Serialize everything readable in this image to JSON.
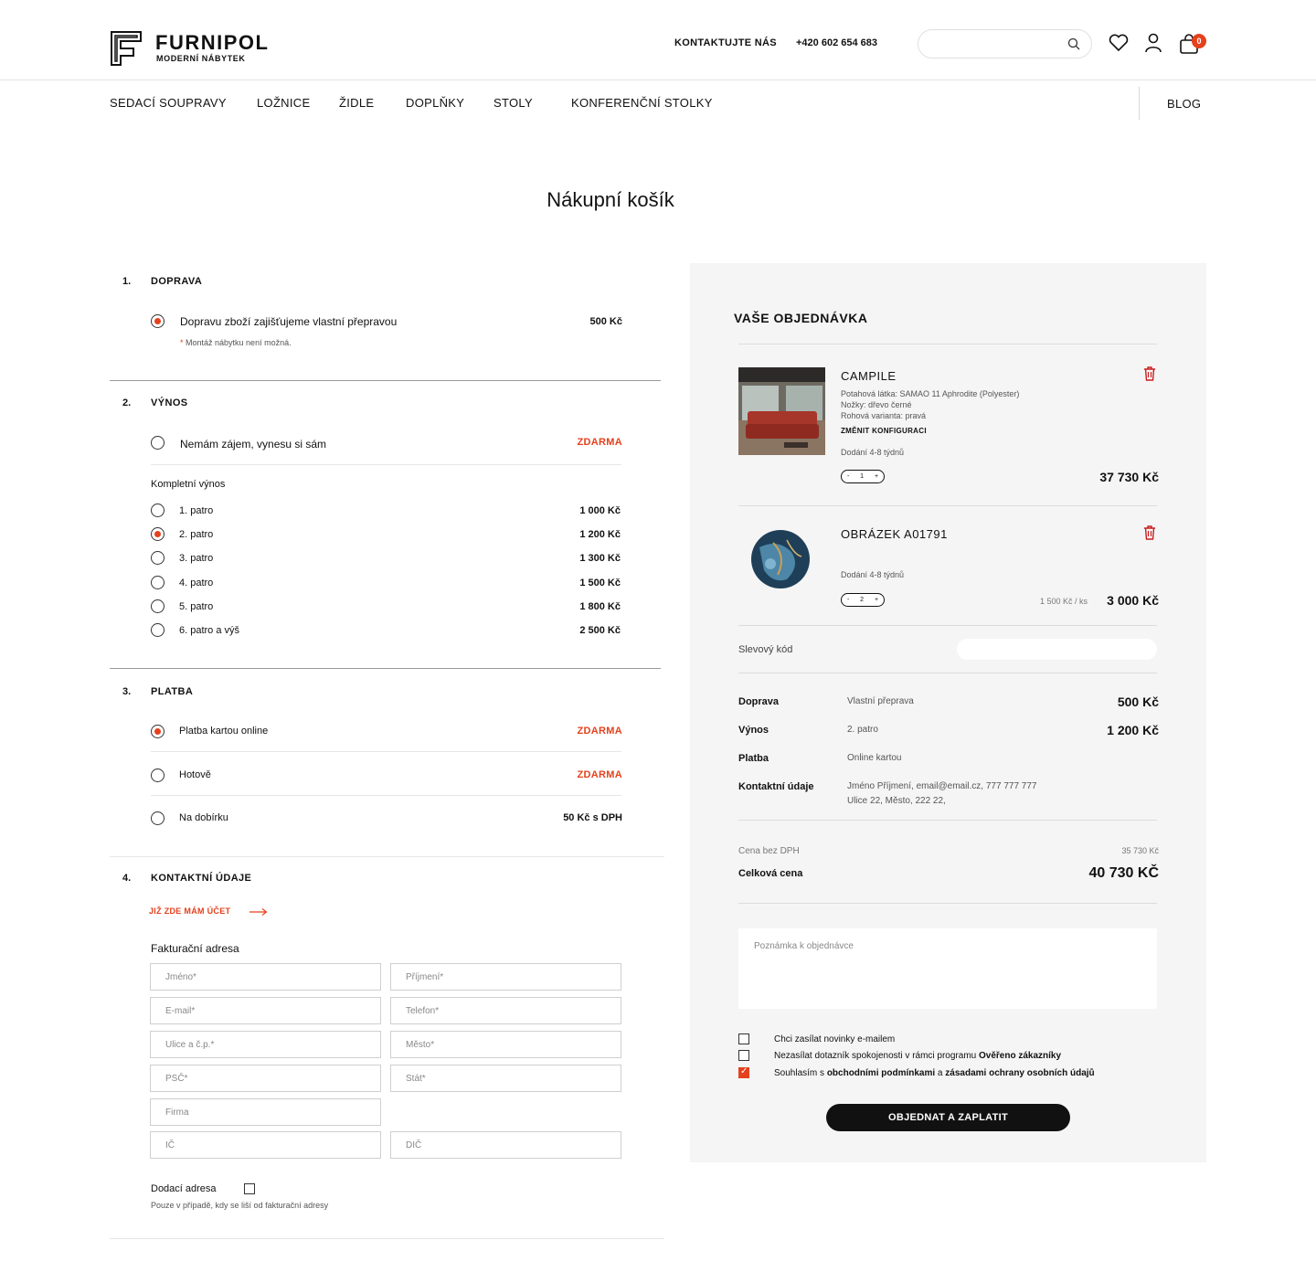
{
  "header": {
    "brand": "FURNIPOL",
    "brand_sub": "MODERNÍ NÁBYTEK",
    "contact_label": "KONTAKTUJTE NÁS",
    "phone": "+420 602 654 683",
    "cart_count": "0"
  },
  "nav": {
    "items": [
      "SEDACÍ SOUPRAVY",
      "LOŽNICE",
      "ŽIDLE",
      "DOPLŇKY",
      "STOLY",
      "KONFERENČNÍ STOLKY"
    ],
    "blog": "BLOG"
  },
  "page_title": "Nákupní košík",
  "shipping": {
    "num": "1.",
    "title": "DOPRAVA",
    "option_label": "Dopravu zboží zajišťujeme vlastní přepravou",
    "option_price": "500 Kč",
    "note_star": "*",
    "note": " Montáž nábytku není možná."
  },
  "carry": {
    "num": "2.",
    "title": "VÝNOS",
    "none_label": "Nemám zájem, vynesu si sám",
    "none_price": "ZDARMA",
    "group_label": "Kompletní výnos",
    "floors": [
      {
        "label": "1. patro",
        "price": "1 000 Kč"
      },
      {
        "label": "2. patro",
        "price": "1 200 Kč"
      },
      {
        "label": "3. patro",
        "price": "1 300 Kč"
      },
      {
        "label": "4. patro",
        "price": "1 500 Kč"
      },
      {
        "label": "5. patro",
        "price": "1 800 Kč"
      },
      {
        "label": "6. patro a výš",
        "price": "2 500 Kč"
      }
    ]
  },
  "payment": {
    "num": "3.",
    "title": "PLATBA",
    "options": [
      {
        "label": "Platba kartou online",
        "price": "ZDARMA"
      },
      {
        "label": "Hotově",
        "price": "ZDARMA"
      },
      {
        "label": "Na dobírku",
        "price": "50 Kč s DPH"
      }
    ]
  },
  "contact": {
    "num": "4.",
    "title": "KONTAKTNÍ ÚDAJE",
    "login_link": "JIŽ ZDE MÁM ÚČET",
    "billing_label": "Fakturační adresa",
    "placeholders": {
      "first_name": "Jméno*",
      "last_name": "Příjmení*",
      "email": "E-mail*",
      "phone": "Telefon*",
      "street": "Ulice a č.p.*",
      "city": "Město*",
      "zip": "PSČ*",
      "country": "Stát*",
      "company": "Firma",
      "ic": "IČ",
      "dic": "DIČ"
    },
    "delivery_label": "Dodací adresa",
    "delivery_note": "Pouze v případě, kdy se liší od fakturační adresy"
  },
  "order": {
    "title": "VAŠE OBJEDNÁVKA",
    "items": [
      {
        "name": "CAMPILE",
        "attr1": "Potahová látka: SAMAO 11 Aphrodite (Polyester)",
        "attr2": "Nožky: dřevo černé",
        "attr3": "Rohová varianta: pravá",
        "change": "ZMĚNIT KONFIGURACI",
        "delivery": "Dodání 4-8 týdnů",
        "qty": "1",
        "price": "37 730 Kč"
      },
      {
        "name": "OBRÁZEK A01791",
        "delivery": "Dodání 4-8 týdnů",
        "qty": "2",
        "unit_price": "1 500 Kč / ks",
        "price": "3 000 Kč"
      }
    ],
    "discount_label": "Slevový kód",
    "summary": {
      "shipping_label": "Doprava",
      "shipping_value": "Vlastní přeprava",
      "shipping_price": "500 Kč",
      "carry_label": "Výnos",
      "carry_value": "2. patro",
      "carry_price": "1 200 Kč",
      "payment_label": "Platba",
      "payment_value": "Online kartou",
      "contact_label": "Kontaktní údaje",
      "contact_line1": "Jméno Příjmení, email@email.cz, 777 777 777",
      "contact_line2": "Ulice 22, Město, 222 22,"
    },
    "price_without_vat_label": "Cena bez DPH",
    "price_without_vat": "35 730 Kč",
    "total_label": "Celková cena",
    "total": "40 730 KČ",
    "note_placeholder": "Poznámka k objednávce",
    "check1": "Chci zasílat novinky e-mailem",
    "check2_pre": "Nezasílat dotazník spokojenosti v rámci programu ",
    "check2_bold": "Ověřeno zákazníky",
    "check3_pre": "Souhlasím s ",
    "check3_bold1": "obchodními podmínkami",
    "check3_mid": " a ",
    "check3_bold2": "zásadami ochrany osobních údajů",
    "submit": "OBJEDNAT A ZAPLATIT"
  },
  "colors": {
    "accent": "#e5411d",
    "panel": "#f5f5f5"
  }
}
